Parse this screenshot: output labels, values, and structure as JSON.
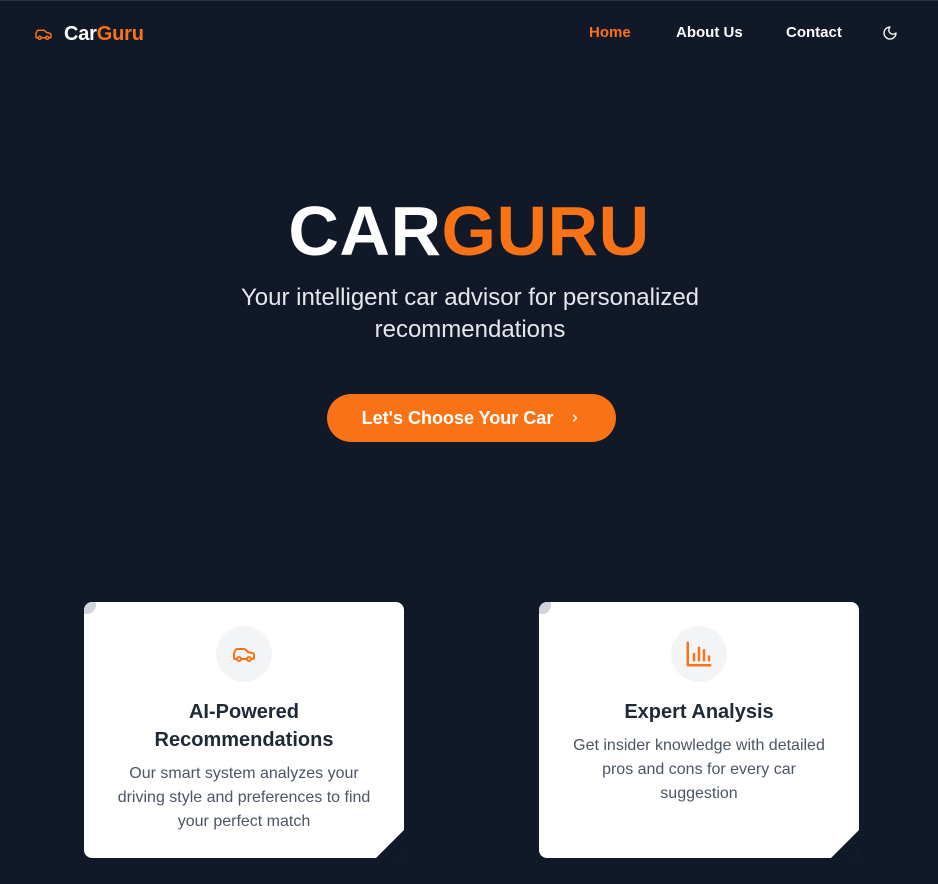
{
  "nav": {
    "brand_part1": "Car",
    "brand_part2": "Guru",
    "brand_icon": "car-icon",
    "links": [
      {
        "label": "Home",
        "active": true
      },
      {
        "label": "About Us",
        "active": false
      },
      {
        "label": "Contact",
        "active": false
      }
    ],
    "theme_icon": "moon-icon"
  },
  "hero": {
    "title_part1": "CAR",
    "title_part2": "GURU",
    "subtitle": "Your intelligent car advisor for personalized recommendations",
    "cta_label": "Let's Choose Your Car",
    "cta_icon": "chevron-right-icon"
  },
  "features": [
    {
      "icon": "car-icon",
      "title": "AI-Powered Recommendations",
      "description": "Our smart system analyzes your driving style and preferences to find your perfect match"
    },
    {
      "icon": "bar-chart-icon",
      "title": "Expert Analysis",
      "description": "Get insider knowledge with detailed pros and cons for every car suggestion"
    }
  ],
  "colors": {
    "background": "#111827",
    "accent": "#f97316",
    "card": "#ffffff",
    "card_title": "#1f2937",
    "card_text": "#4b5563"
  }
}
